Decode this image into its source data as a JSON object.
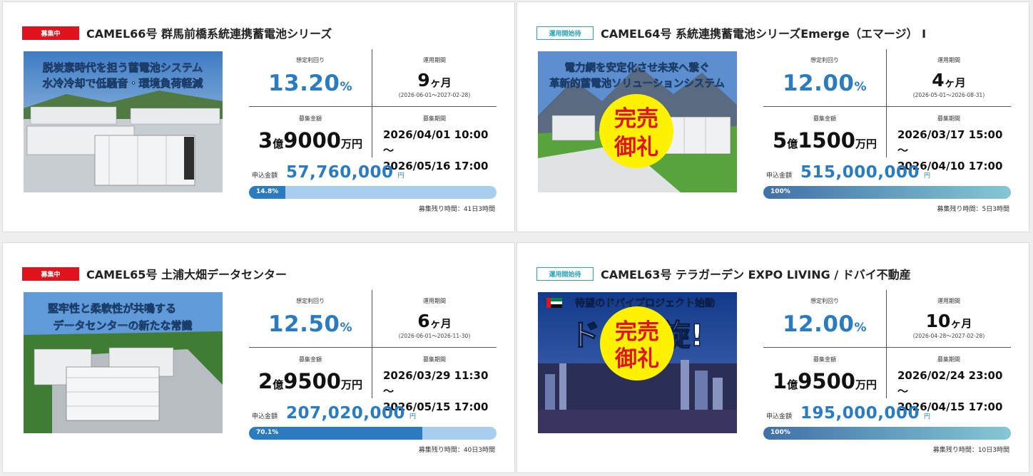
{
  "cards": [
    {
      "badge": "募集中",
      "title": "CAMEL66号 群馬前橋系統連携蓄電池シリーズ",
      "image_caption": [
        "脱炭素時代を担う蓄電池システム",
        "水冷冷却で低騒音・環境負荷軽減"
      ],
      "yield_label": "想定利回り",
      "yield_value": "13.20",
      "yield_unit": "%",
      "period_label": "運用期間",
      "period_value": "9",
      "period_unit": "ヶ月",
      "period_range": "(2026-06-01～2027-02-28)",
      "amount_label": "募集金額",
      "amount_oku": "3",
      "amount_oku_unit": "億",
      "amount_man": "9000",
      "amount_man_unit": "万円",
      "recruit_label": "募集期間",
      "recruit_start": "2026/04/01 10:00～",
      "recruit_end": "2026/05/16 17:00",
      "applied_label": "申込金額",
      "applied_value": "57,760,000",
      "applied_unit": "円",
      "progress_label": "14.8%",
      "progress": 14.8,
      "remaining": "募集残り時間：41日3時間"
    },
    {
      "badge": "運用開始待",
      "title": "CAMEL64号 系統連携蓄電池シリーズEmerge（エマージ） I",
      "image_caption": [
        "電力網を安定化させ未来へ繋ぐ",
        "革新的蓄電池ソリューションシステム"
      ],
      "stamp": [
        "完売",
        "御礼"
      ],
      "yield_label": "想定利回り",
      "yield_value": "12.00",
      "yield_unit": "%",
      "period_label": "運用期間",
      "period_value": "4",
      "period_unit": "ヶ月",
      "period_range": "(2026-05-01～2026-08-31)",
      "amount_label": "募集金額",
      "amount_oku": "5",
      "amount_oku_unit": "億",
      "amount_man": "1500",
      "amount_man_unit": "万円",
      "recruit_label": "募集期間",
      "recruit_start": "2026/03/17 15:00～",
      "recruit_end": "2026/04/10 17:00",
      "applied_label": "申込金額",
      "applied_value": "515,000,000",
      "applied_unit": "円",
      "progress_label": "100%",
      "progress": 100,
      "remaining": "募集残り時間：5日3時間"
    },
    {
      "badge": "募集中",
      "title": "CAMEL65号 土浦大畑データセンター",
      "image_caption": [
        "堅牢性と柔軟性が共鳴する",
        "データセンターの新たな常識"
      ],
      "yield_label": "想定利回り",
      "yield_value": "12.50",
      "yield_unit": "%",
      "period_label": "運用期間",
      "period_value": "6",
      "period_unit": "ヶ月",
      "period_range": "(2026-06-01～2026-11-30)",
      "amount_label": "募集金額",
      "amount_oku": "2",
      "amount_oku_unit": "億",
      "amount_man": "9500",
      "amount_man_unit": "万円",
      "recruit_label": "募集期間",
      "recruit_start": "2026/03/29 11:30～",
      "recruit_end": "2026/05/15 17:00",
      "applied_label": "申込金額",
      "applied_value": "207,020,000",
      "applied_unit": "円",
      "progress_label": "70.1%",
      "progress": 70.1,
      "remaining": "募集残り時間：40日3時間"
    },
    {
      "badge": "運用開始待",
      "title": "CAMEL63号 テラガーデン EXPO LIVING / ドバイ不動産",
      "image_caption": [
        "待望のドバイプロジェクト始動",
        "ドバイ旋!"
      ],
      "stamp": [
        "完売",
        "御礼"
      ],
      "yield_label": "想定利回り",
      "yield_value": "12.00",
      "yield_unit": "%",
      "period_label": "運用期間",
      "period_value": "10",
      "period_unit": "ヶ月",
      "period_range": "(2026-04-28～2027-02-28)",
      "amount_label": "募集金額",
      "amount_oku": "1",
      "amount_oku_unit": "億",
      "amount_man": "9500",
      "amount_man_unit": "万円",
      "recruit_label": "募集期間",
      "recruit_start": "2026/02/24 23:00～",
      "recruit_end": "2026/04/15 17:00",
      "applied_label": "申込金額",
      "applied_value": "195,000,000",
      "applied_unit": "円",
      "progress_label": "100%",
      "progress": 100,
      "remaining": "募集残り時間：10日3時間"
    }
  ],
  "colors": {
    "accent": "#2b7bc0",
    "badge_red": "#e0131d",
    "badge_teal": "#2aa3b8",
    "bar_bg": "#a9cdef",
    "stamp_yellow": "#fff200",
    "stamp_red": "#e0131d"
  }
}
